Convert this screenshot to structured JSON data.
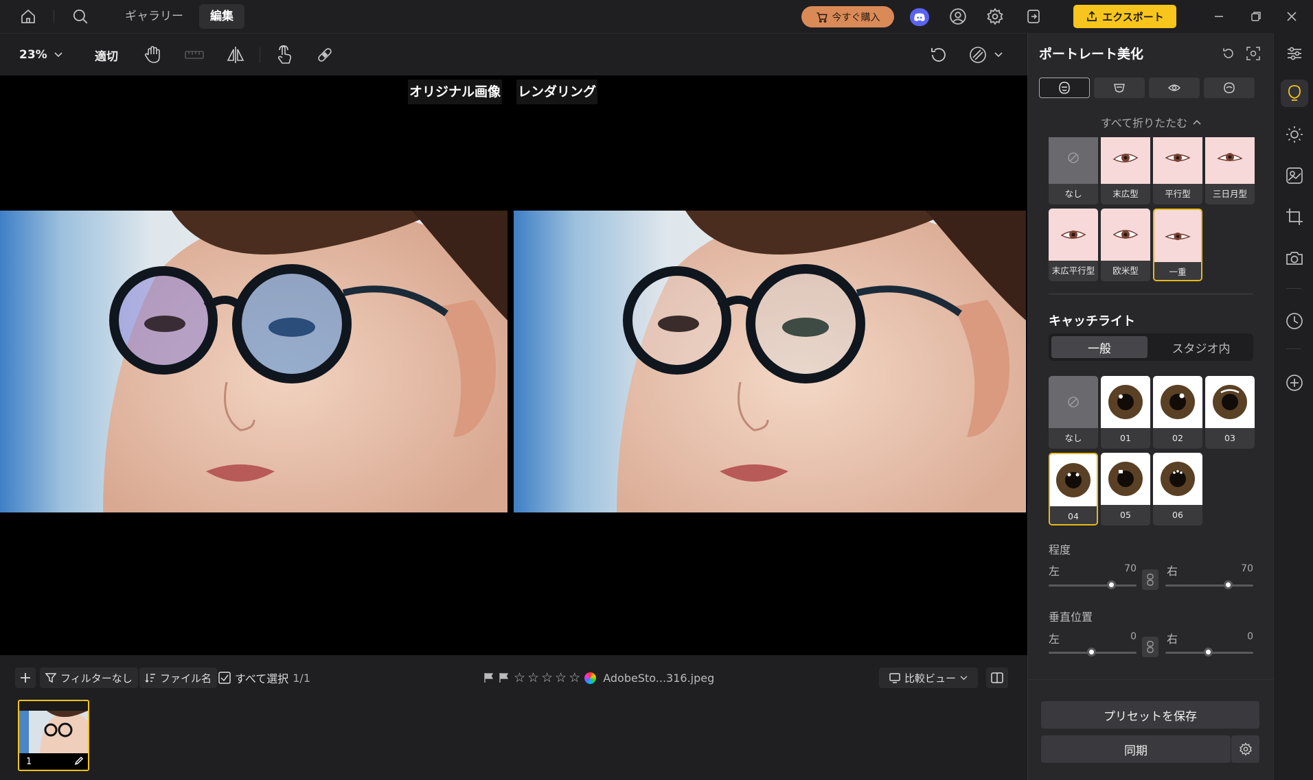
{
  "topbar": {
    "tabs": [
      "ギャラリー",
      "編集"
    ],
    "buy_label": "今すぐ購入",
    "export_label": "エクスポート"
  },
  "toolbar": {
    "zoom": "23%",
    "fit_label": "適切"
  },
  "canvas": {
    "original_label": "オリジナル画像",
    "rendered_label": "レンダリング"
  },
  "filmbar": {
    "filter_label": "フィルターなし",
    "sort_label": "ファイル名",
    "select_all_label": "すべて選択",
    "selection_count": "1/1",
    "filename": "AdobeSto...316.jpeg",
    "view_label": "比較ビュー",
    "thumb_index": "1"
  },
  "panel": {
    "title": "ポートレート美化",
    "collapse_label": "すべて折りたたむ",
    "eye_shapes": [
      {
        "label": "なし"
      },
      {
        "label": "末広型"
      },
      {
        "label": "平行型"
      },
      {
        "label": "三日月型"
      },
      {
        "label": "末広平行型"
      },
      {
        "label": "欧米型"
      },
      {
        "label": "一重"
      }
    ],
    "catchlight": {
      "title": "キャッチライト",
      "modes": [
        "一般",
        "スタジオ内"
      ],
      "options": [
        "なし",
        "01",
        "02",
        "03",
        "04",
        "05",
        "06"
      ]
    },
    "intensity": {
      "title": "程度",
      "left_label": "左",
      "right_label": "右",
      "left_value": "70",
      "right_value": "70"
    },
    "vertical": {
      "title": "垂直位置",
      "left_label": "左",
      "right_label": "右",
      "left_value": "0",
      "right_value": "0"
    },
    "save_preset_label": "プリセットを保存",
    "sync_label": "同期"
  }
}
